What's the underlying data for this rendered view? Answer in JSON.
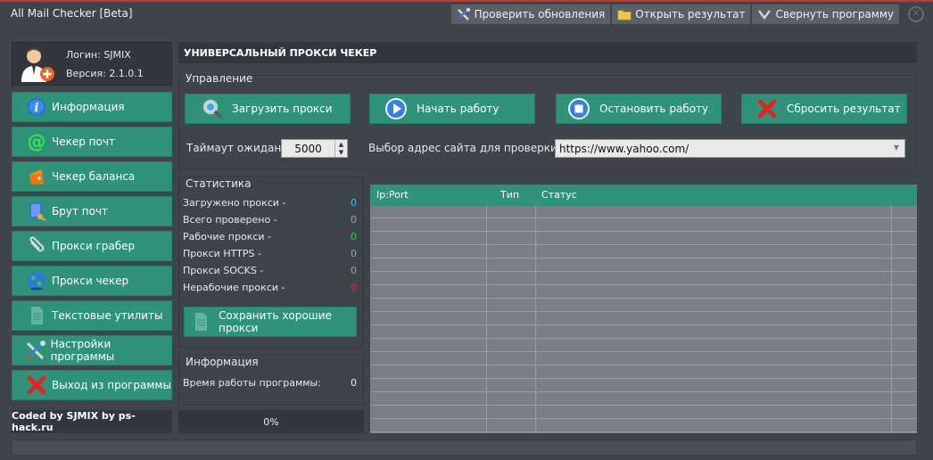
{
  "window": {
    "title": "All Mail Checker [Beta]"
  },
  "top_actions": {
    "check_updates": "Проверить обновления",
    "open_result": "Открыть результат",
    "minimize": "Свернуть программу",
    "close_glyph": "✕"
  },
  "profile": {
    "login": "Логин: SJMIX",
    "version": "Версия: 2.1.0.1"
  },
  "sidebar": {
    "items": [
      {
        "label": "Информация",
        "icon": "info-icon"
      },
      {
        "label": "Чекер почт",
        "icon": "at-icon"
      },
      {
        "label": "Чекер баланса",
        "icon": "wallet-icon"
      },
      {
        "label": "Брут почт",
        "icon": "notebook-key-icon"
      },
      {
        "label": "Прокси грабер",
        "icon": "paperclip-icon"
      },
      {
        "label": "Прокси чекер",
        "icon": "globe-icon"
      },
      {
        "label": "Текстовые утилиты",
        "icon": "document-icon"
      },
      {
        "label": "Настройки программы",
        "icon": "tools-icon"
      },
      {
        "label": "Выход из программы",
        "icon": "red-x-icon"
      }
    ],
    "coded_by": "Coded by SJMIX by ps-hack.ru"
  },
  "main": {
    "header": "УНИВЕРСАЛЬНЫЙ ПРОКСИ ЧЕКЕР",
    "control_group": "Управление",
    "buttons": {
      "load": "Загрузить прокси",
      "start": "Начать работу",
      "stop": "Остановить работу",
      "reset": "Сбросить результат"
    },
    "timeout_label": "Таймаут ожидания:",
    "timeout_value": "5000",
    "url_label": "Выбор адрес сайта для проверки:",
    "url_value": "https://www.yahoo.com/"
  },
  "stats": {
    "title": "Статистика",
    "rows": [
      {
        "label": "Загружено прокси -",
        "value": "0",
        "color": "#2ec4e8"
      },
      {
        "label": "Всего проверено -",
        "value": "0",
        "color": "#9a9da2"
      },
      {
        "label": "Рабочие прокси -",
        "value": "0",
        "color": "#2ecc40"
      },
      {
        "label": "Прокси HTTPS -",
        "value": "0",
        "color": "#9a9da2"
      },
      {
        "label": "Прокси SOCKS -",
        "value": "0",
        "color": "#9a9da2"
      },
      {
        "label": "Нерабочие прокси -",
        "value": "0",
        "color": "#e02b2b"
      }
    ],
    "save_button": "Сохранить хорошие прокси"
  },
  "info": {
    "title": "Информация",
    "uptime_label": "Время работы программы:",
    "uptime_value": "0"
  },
  "progress": {
    "label": "0%",
    "fraction": 0
  },
  "table": {
    "columns": [
      "Ip:Port",
      "Тип",
      "Статус"
    ]
  },
  "colors": {
    "accent": "#2f9379",
    "background": "#3f444b",
    "panel": "#33373d",
    "top_line": "#c0392b"
  }
}
